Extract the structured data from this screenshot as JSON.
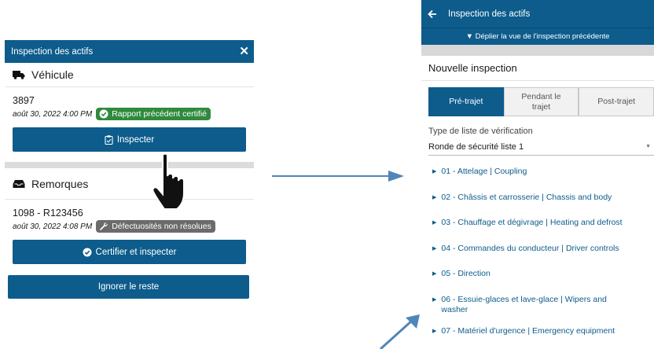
{
  "left": {
    "header_title": "Inspection des actifs",
    "close_icon": "close-icon",
    "vehicle": {
      "section_title": "Véhicule",
      "icon": "truck-icon",
      "id": "3897",
      "date": "août 30, 2022 4:00 PM",
      "badge": "Rapport précédent certifié",
      "badge_color": "#2f8a3d",
      "button_label": "Inspecter"
    },
    "trailers": {
      "section_title": "Remorques",
      "icon": "inbox-icon",
      "id": "1098 - R123456",
      "date": "août 30, 2022 4:08 PM",
      "badge": "Défectuosités non résolues",
      "badge_color": "#6b6b6b",
      "button_label": "Certifier et inspecter"
    },
    "ignore_button": "Ignorer le reste"
  },
  "right": {
    "header_title": "Inspection des actifs",
    "expand_label": "▼ Déplier la vue de l'inspection précédente",
    "section_title": "Nouvelle inspection",
    "segments": [
      "Pré-trajet",
      "Pendant le trajet",
      "Post-trajet"
    ],
    "active_segment": 0,
    "checklist_label": "Type de liste de vérification",
    "checklist_value": "Ronde de sécurité liste 1",
    "items": [
      "01 - Attelage | Coupling",
      "02 - Châssis et carrosserie | Chassis and body",
      "03 - Chauffage et dégivrage | Heating and defrost",
      "04 - Commandes du conducteur | Driver controls",
      "05 - Direction",
      "06 - Essuie-glaces et lave-glace | Wipers and washer",
      "07 - Matériel d'urgence | Emergency equipment"
    ]
  },
  "colors": {
    "primary": "#0d5c8c",
    "arrow": "#4f86b8"
  }
}
